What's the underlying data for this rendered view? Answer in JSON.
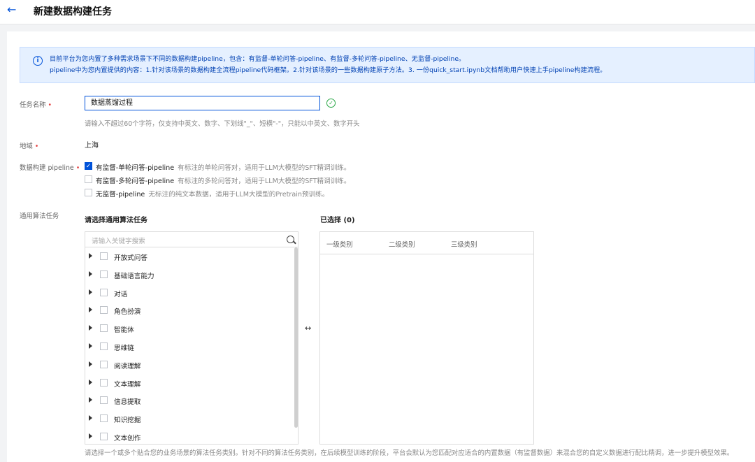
{
  "header": {
    "back_icon": "arrow-left-icon",
    "title": "新建数据构建任务"
  },
  "notice": {
    "icon": "info-icon",
    "line1": "目前平台为您内置了多种需求场景下不同的数据构建pipeline，包含：有监督-单轮问答-pipeline、有监督-多轮问答-pipeline、无监督-pipeline。",
    "line2": "pipeline中为您内置提供的内容：1.针对该场景的数据构建全流程pipeline代码框架。2.针对该场景的一些数据构建原子方法。3. 一份quick_start.ipynb文档帮助用户快速上手pipeline构建流程。"
  },
  "form": {
    "task_name_label": "任务名称",
    "task_name_value": "数据蒸馏过程",
    "task_name_hint": "请输入不超过60个字符，仅支持中英文、数字、下划线\"_\"、短横\"-\"，只能以中英文、数字开头",
    "region_label": "地域",
    "region_value": "上海",
    "pipeline_label": "数据构建 pipeline",
    "required_mark": "•",
    "pipelines": [
      {
        "name": "有监督-单轮问答-pipeline",
        "desc": "有标注的单轮问答对，适用于LLM大模型的SFT精调训练。",
        "checked": true
      },
      {
        "name": "有监督-多轮问答-pipeline",
        "desc": "有标注的多轮问答对，适用于LLM大模型的SFT精调训练。",
        "checked": false
      },
      {
        "name": "无监督-pipeline",
        "desc": "无标注的纯文本数据，适用于LLM大模型的Pretrain预训练。",
        "checked": false
      }
    ],
    "algo_label": "通用算法任务",
    "select_title": "请选择通用算法任务",
    "selected_title": "已选择 (0)",
    "search_placeholder": "请输入关键字搜索",
    "tree_items": [
      "开放式问答",
      "基础语言能力",
      "对话",
      "角色扮演",
      "智能体",
      "思维链",
      "阅读理解",
      "文本理解",
      "信息提取",
      "知识挖掘",
      "文本创作"
    ],
    "columns": [
      "一级类别",
      "二级类别",
      "三级类别"
    ],
    "bottom_hint": "请选择一个或多个贴合您的业务场景的算法任务类别。针对不同的算法任务类别，在后续模型训练的阶段，平台会默认为您匹配对应适合的内置数据（有监督数据）来混合您的自定义数据进行配比精调，进一步提升模型效果。"
  },
  "colors": {
    "accent": "#0052d9",
    "notice_bg": "#e5f0ff",
    "required": "#e54545",
    "success": "#28a745"
  }
}
